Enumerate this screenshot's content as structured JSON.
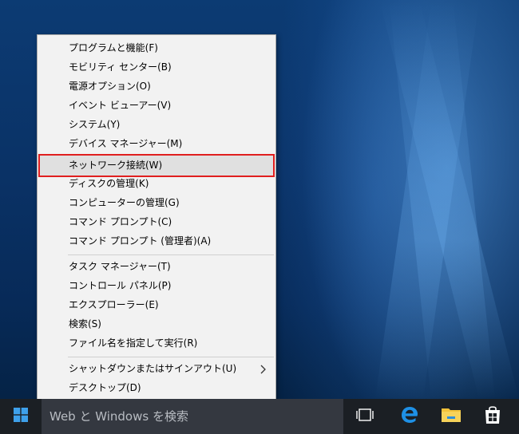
{
  "menu": {
    "items": [
      {
        "label": "プログラムと機能(F)"
      },
      {
        "label": "モビリティ センター(B)"
      },
      {
        "label": "電源オプション(O)"
      },
      {
        "label": "イベント ビューアー(V)"
      },
      {
        "label": "システム(Y)"
      },
      {
        "label": "デバイス マネージャー(M)"
      },
      {
        "label": "ネットワーク接続(W)"
      },
      {
        "label": "ディスクの管理(K)"
      },
      {
        "label": "コンピューターの管理(G)"
      },
      {
        "label": "コマンド プロンプト(C)"
      },
      {
        "label": "コマンド プロンプト (管理者)(A)"
      },
      {
        "label": "タスク マネージャー(T)"
      },
      {
        "label": "コントロール パネル(P)"
      },
      {
        "label": "エクスプローラー(E)"
      },
      {
        "label": "検索(S)"
      },
      {
        "label": "ファイル名を指定して実行(R)"
      },
      {
        "label": "シャットダウンまたはサインアウト(U)"
      },
      {
        "label": "デスクトップ(D)"
      }
    ],
    "highlighted_item": "ネットワーク接続(W)",
    "highlight_color": "#e01f1f"
  },
  "taskbar": {
    "search_text": "Web と Windows を検索",
    "icons": [
      "windows-start-icon",
      "task-view-icon",
      "edge-browser-icon",
      "file-explorer-icon",
      "store-icon"
    ],
    "accent": "#0078d7"
  }
}
